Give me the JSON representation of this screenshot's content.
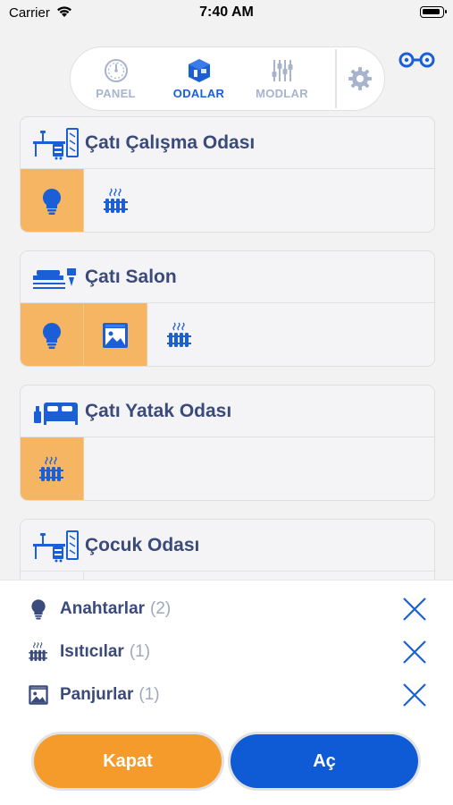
{
  "status_bar": {
    "carrier": "Carrier",
    "time": "7:40 AM"
  },
  "nav": {
    "tabs": [
      {
        "label": "PANEL",
        "icon": "gauge-icon",
        "active": false
      },
      {
        "label": "ODALAR",
        "icon": "cube-room-icon",
        "active": true
      },
      {
        "label": "MODLAR",
        "icon": "sliders-icon",
        "active": false
      }
    ],
    "settings_icon": "gear-icon",
    "link_icon": "link-icon"
  },
  "rooms": [
    {
      "name": "Çatı Çalışma Odası",
      "icon": "desk-icon",
      "devices": [
        {
          "type": "light",
          "on": true
        },
        {
          "type": "heater",
          "on": false
        }
      ]
    },
    {
      "name": "Çatı Salon",
      "icon": "sofa-lamp-icon",
      "devices": [
        {
          "type": "light",
          "on": true
        },
        {
          "type": "shutter",
          "on": true
        },
        {
          "type": "heater",
          "on": false
        }
      ]
    },
    {
      "name": "Çatı Yatak Odası",
      "icon": "bed-icon",
      "devices": [
        {
          "type": "heater",
          "on": true
        }
      ]
    },
    {
      "name": "Çocuk Odası",
      "icon": "desk-icon",
      "devices": []
    }
  ],
  "device_types": [
    {
      "name": "Anahtarlar",
      "count": "(2)",
      "icon": "bulb-icon"
    },
    {
      "name": "Isıtıcılar",
      "count": "(1)",
      "icon": "heater-icon"
    },
    {
      "name": "Panjurlar",
      "count": "(1)",
      "icon": "shutter-icon"
    }
  ],
  "actions": {
    "off_label": "Kapat",
    "on_label": "Aç"
  },
  "colors": {
    "accent_blue": "#1a5fd6",
    "on_orange": "#f5b562",
    "button_orange": "#f59b2c",
    "button_blue": "#0f5bd6",
    "text_navy": "#3a4a7a"
  }
}
